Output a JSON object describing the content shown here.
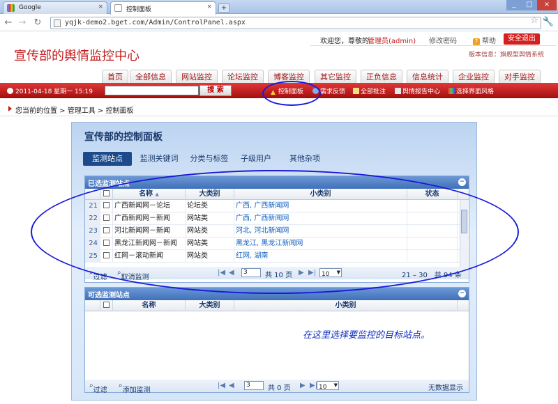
{
  "browser": {
    "tabs": [
      {
        "title": "Google"
      },
      {
        "title": "控制面板"
      }
    ],
    "new_tab": "+",
    "window_controls": [
      "_",
      "□",
      "×"
    ],
    "url": "yqjk-demo2.bget.com/Admin/ControlPanel.aspx"
  },
  "header": {
    "welcome": "欢迎您，尊敬的",
    "user": "管理员(admin)",
    "change_password": "修改密码",
    "help": "帮助",
    "logout": "安全退出",
    "site_title": "宣传部的舆情监控中心",
    "version": "版本信息：旗舰型舆情系统"
  },
  "nav": {
    "items": [
      "首页",
      "全部信息",
      "网站监控",
      "论坛监控",
      "博客监控",
      "其它监控",
      "正负信息",
      "信息统计",
      "企业监控",
      "对手监控"
    ]
  },
  "toolbar": {
    "date": "2011-04-18 星期一 15:19",
    "search_value": "",
    "search_button": "搜 索",
    "links": [
      "控制面板",
      "需求反馈",
      "全部批注",
      "舆情报告中心",
      "选择界面风格"
    ]
  },
  "breadcrumb": {
    "text": "您当前的位置 > 管理工具 > 控制面板"
  },
  "panel": {
    "title": "宣传部的控制面板",
    "tabs": [
      "监测站点",
      "监测关键词",
      "分类与标签",
      "子级用户",
      "其他杂项"
    ],
    "active_tab": "监测站点"
  },
  "selected_grid": {
    "title": "已选监测站点",
    "columns": [
      "名称",
      "大类别",
      "小类别",
      "状态"
    ],
    "sort_arrow": "▲",
    "rows": [
      {
        "num": "21",
        "name": "广西新闻网－论坛",
        "category": "论坛类",
        "sub": "广西, 广西新闻网",
        "status": ""
      },
      {
        "num": "22",
        "name": "广西新闻网－新闻",
        "category": "网站类",
        "sub": "广西, 广西新闻网",
        "status": ""
      },
      {
        "num": "23",
        "name": "河北新闻网－新闻",
        "category": "网站类",
        "sub": "河北, 河北新闻网",
        "status": ""
      },
      {
        "num": "24",
        "name": "黑龙江新闻网－新闻",
        "category": "网站类",
        "sub": "黑龙江, 黑龙江新闻网",
        "status": ""
      },
      {
        "num": "25",
        "name": "红网－滚动新闻",
        "category": "网站类",
        "sub": "红网, 湖南",
        "status": ""
      }
    ],
    "filter": "过滤",
    "action": "取消监测",
    "page_input": "3",
    "page_total": "共 10 页",
    "page_size": "10",
    "range": "21 – 30　共 94 条"
  },
  "available_grid": {
    "title": "可选监测站点",
    "columns": [
      "名称",
      "大类别",
      "小类别"
    ],
    "filter": "过滤",
    "action": "添加监测",
    "page_input": "3",
    "page_total": "共 0 页",
    "page_size": "10",
    "empty": "无数据显示"
  },
  "pager_arrows": [
    "|◀",
    "◀",
    "▶",
    "▶|"
  ],
  "annotation": "在这里选择要监控的目标站点。",
  "colors": {
    "brand_red": "#c41a1a",
    "bar_red": "#c01818",
    "panel_blue": "#3f70b9",
    "annotation_blue": "#1a1ad8"
  }
}
